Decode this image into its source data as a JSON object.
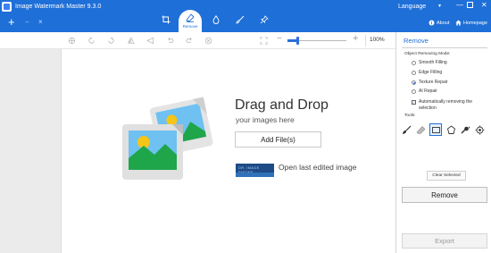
{
  "window": {
    "title": "Image Watermark Master 9.3.0",
    "language_label": "Language",
    "about_label": "About",
    "homepage_label": "Homepage"
  },
  "title_toolbar": {
    "new_symbol": "+",
    "minus_symbol": "−",
    "close_symbol": "×",
    "tabs": [
      {
        "icon": "crop-icon",
        "label": ""
      },
      {
        "icon": "eraser-icon",
        "label": "Remove",
        "active": true
      },
      {
        "icon": "drop-icon",
        "label": ""
      },
      {
        "icon": "brush-icon",
        "label": ""
      },
      {
        "icon": "pin-icon",
        "label": ""
      }
    ]
  },
  "canvas_toolbar": {
    "icons": [
      "move-icon",
      "rotate-left-icon",
      "rotate-right-icon",
      "flip-horizontal-icon",
      "flip-vertical-icon",
      "undo-icon",
      "redo-icon",
      "cancel-icon",
      "fit-screen-icon"
    ],
    "zoom_minus": "−",
    "zoom_plus": "+",
    "zoom_level": 0.17,
    "zoom_percent": "100%"
  },
  "drop_area": {
    "title": "Drag and Drop",
    "subtitle": "your images here",
    "add_button": "Add File(s)",
    "open_last": "Open last edited image",
    "recent_thumb_text": "DR. IMAGE SHOWS",
    "illustration_icon": "images-icon"
  },
  "panel": {
    "title": "Remove",
    "mode_label": "Object Removing Mode:",
    "modes": [
      {
        "label": "Smooth Filling",
        "selected": false
      },
      {
        "label": "Edge Filling",
        "selected": false
      },
      {
        "label": "Texture Repair",
        "selected": true
      },
      {
        "label": "AI Repair",
        "selected": false
      }
    ],
    "auto_remove_label": "Automatically removing the selection",
    "auto_remove_checked": true,
    "tools_label": "Tools:",
    "tools": [
      "brush-icon",
      "eraser-icon",
      "rectangle-select-icon",
      "lasso-icon",
      "magic-brush-icon",
      "target-icon"
    ],
    "clear_button": "Clear Selected",
    "remove_button": "Remove",
    "export_button": "Export"
  },
  "colors": {
    "accent": "#1f6fd8",
    "titlebar": "#1f6fd8",
    "illustration_blue": "#6ec1f0",
    "illustration_green": "#1fa64a",
    "illustration_sun": "#f5c518"
  }
}
